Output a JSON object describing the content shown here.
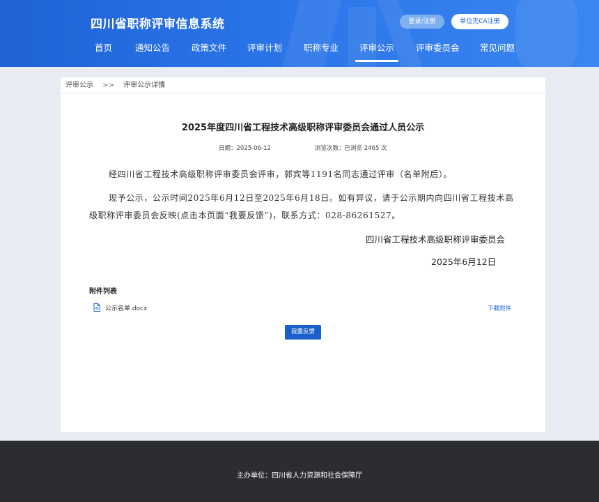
{
  "header": {
    "site_title": "四川省职称评审信息系统",
    "login_label": "登录/注册",
    "unit_register_label": "单位无CA注册",
    "nav": [
      {
        "label": "首页"
      },
      {
        "label": "通知公告"
      },
      {
        "label": "政策文件"
      },
      {
        "label": "评审计划"
      },
      {
        "label": "职称专业"
      },
      {
        "label": "评审公示",
        "active": true
      },
      {
        "label": "评审委员会"
      },
      {
        "label": "常见问题"
      }
    ]
  },
  "breadcrumb": {
    "items": [
      "评审公示",
      "评审公示详情"
    ],
    "separator": ">>"
  },
  "article": {
    "title": "2025年度四川省工程技术高级职称评审委员会通过人员公示",
    "date": "日期：2025-06-12",
    "views": "浏览次数：已浏览 2465 次",
    "paragraph1": "经四川省工程技术高级职称评审委员会评审，郭宾等1191名同志通过评审（名单附后）。",
    "paragraph2": "现予公示，公示时间2025年6月12日至2025年6月18日。如有异议，请于公示期内向四川省工程技术高级职称评审委员会反映(点击本页面“我要反馈”)，联系方式：028-86261527。",
    "signature": "四川省工程技术高级职称评审委员会",
    "signature_date": "2025年6月12日"
  },
  "attachments": {
    "heading": "附件列表",
    "items": [
      {
        "name": "公示名单.docx",
        "download_label": "下载附件",
        "icon": "document-icon"
      }
    ]
  },
  "feedback_label": "我要反馈",
  "footer": {
    "text": "主办单位：四川省人力资源和社会保障厅"
  },
  "colors": {
    "header_blue": "#2a74e8",
    "button_blue": "#1a5fc9",
    "link_blue": "#1a66cc",
    "footer_dark": "#2b2d33"
  }
}
